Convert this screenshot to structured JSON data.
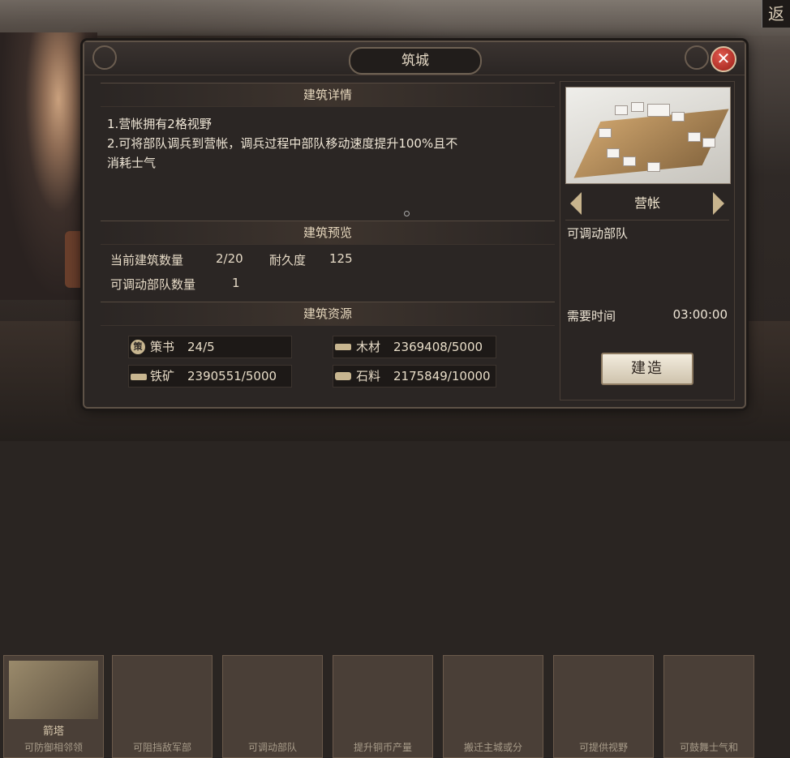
{
  "corner": {
    "back_char": "返"
  },
  "bottom_cards": [
    {
      "label": "箭塔",
      "desc": "可防御相邻领"
    },
    {
      "label": "",
      "desc": "可阻挡敌军部"
    },
    {
      "label": "",
      "desc": "可调动部队"
    },
    {
      "label": "",
      "desc": "提升铜币产量"
    },
    {
      "label": "",
      "desc": "搬迁主城或分"
    },
    {
      "label": "",
      "desc": "可提供视野"
    },
    {
      "label": "",
      "desc": "可鼓舞士气和"
    }
  ],
  "modal": {
    "title": "筑城",
    "close_symbol": "✕",
    "details": {
      "header": "建筑详情",
      "lines": [
        "1.营帐拥有2格视野",
        "2.可将部队调兵到营帐，调兵过程中部队移动速度提升100%且不",
        "消耗士气"
      ]
    },
    "preview": {
      "header": "建筑预览",
      "count_label": "当前建筑数量",
      "count_value": "2/20",
      "durability_label": "耐久度",
      "durability_value": "125",
      "troops_label": "可调动部队数量",
      "troops_value": "1"
    },
    "resources": {
      "header": "建筑资源",
      "items": [
        {
          "icon": "策",
          "icon_name": "strategy-book-icon",
          "name": "策书",
          "value": "24/5"
        },
        {
          "icon": "",
          "icon_name": "wood-icon",
          "name": "木材",
          "value": "2369408/5000"
        },
        {
          "icon": "",
          "icon_name": "iron-ore-icon",
          "name": "铁矿",
          "value": "2390551/5000"
        },
        {
          "icon": "",
          "icon_name": "stone-icon",
          "name": "石料",
          "value": "2175849/10000"
        }
      ]
    },
    "building": {
      "name": "营帐",
      "desc": "可调动部队",
      "time_label": "需要时间",
      "time_value": "03:00:00",
      "build_label": "建造"
    }
  }
}
